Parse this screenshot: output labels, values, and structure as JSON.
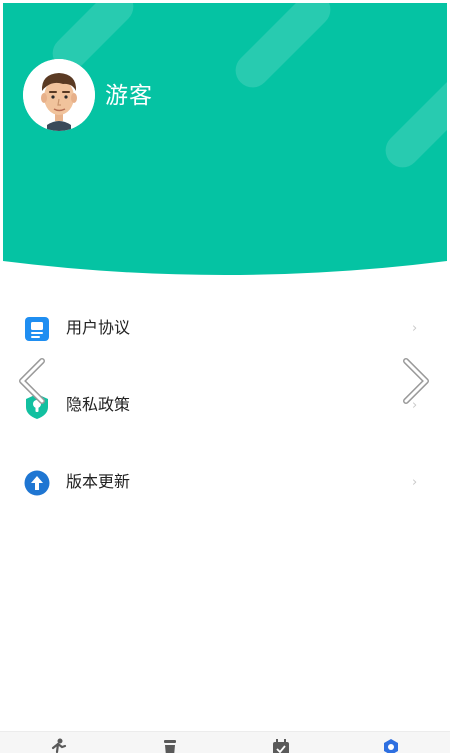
{
  "profile": {
    "username": "游客"
  },
  "menu": {
    "items": [
      {
        "label": "用户协议",
        "icon": "document-icon",
        "color": "#1f8ef1"
      },
      {
        "label": "隐私政策",
        "icon": "shield-lock-icon",
        "color": "#12c0a0"
      },
      {
        "label": "版本更新",
        "icon": "upload-arrow-icon",
        "color": "#1f76d2"
      }
    ],
    "chevron": "›"
  },
  "colors": {
    "header": "#05c3a3",
    "tab_active": "#2e6fe0",
    "tab_inactive": "#5a5a5a"
  },
  "tabbar": {
    "tabs": [
      {
        "icon": "run-icon",
        "active": false
      },
      {
        "icon": "cup-icon",
        "active": false
      },
      {
        "icon": "calendar-icon",
        "active": false
      },
      {
        "icon": "settings-icon",
        "active": true
      }
    ]
  }
}
